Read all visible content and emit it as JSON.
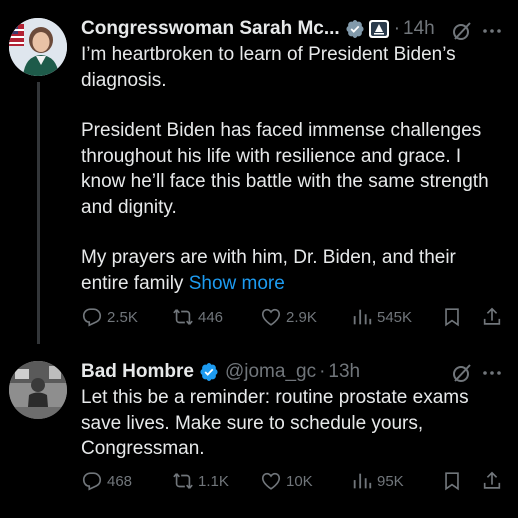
{
  "tweets": [
    {
      "author_name": "Congresswoman Sarah Mc...",
      "time": "14h",
      "separator": "·",
      "paragraphs": [
        "I’m heartbroken to learn of President Biden’s diagnosis.",
        "President Biden has faced immense challenges throughout his life with resilience and grace. I know he’ll face this battle with the same strength and dignity.",
        "My prayers are with him, Dr. Biden, and their entire family"
      ],
      "show_more": "Show more",
      "replies": "2.5K",
      "reposts": "446",
      "likes": "2.9K",
      "views": "545K",
      "icons": [
        "avatar",
        "verified-badge-icon",
        "government-badge-icon",
        "grok-icon",
        "more-icon",
        "reply-icon",
        "repost-icon",
        "like-icon",
        "views-icon",
        "bookmark-icon",
        "share-icon"
      ]
    },
    {
      "author_name": "Bad Hombre",
      "handle": "@joma_gc",
      "time": "13h",
      "separator": "·",
      "paragraphs": [
        "Let this be a reminder: routine prostate exams save lives. Make sure to schedule yours, Congressman."
      ],
      "replies": "468",
      "reposts": "1.1K",
      "likes": "10K",
      "views": "95K"
    }
  ],
  "colors": {
    "background": "#000000",
    "text": "#e7e9ea",
    "muted": "#71767b",
    "link": "#1d9bf0",
    "verified": "#1d9bf0",
    "gov_badge": "#829aab"
  }
}
